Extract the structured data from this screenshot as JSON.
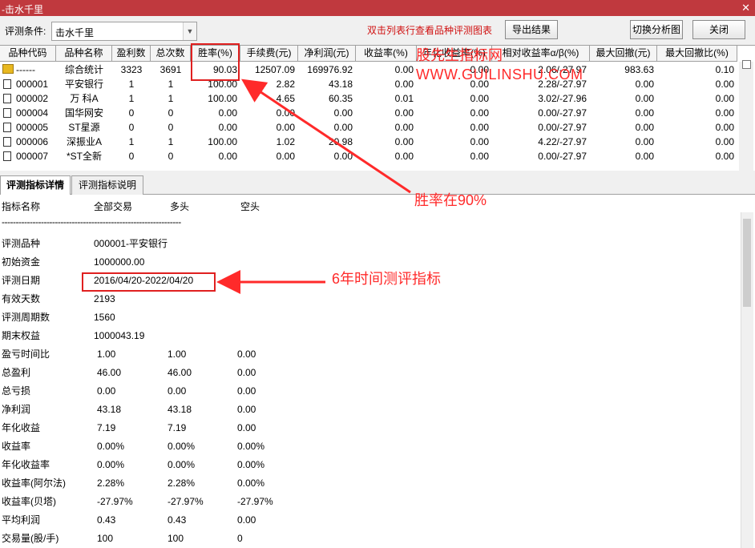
{
  "window": {
    "title": "-击水千里",
    "close_label": "✕"
  },
  "toolbar": {
    "condition_label": "评测条件:",
    "condition_value": "击水千里",
    "hint": "双击列表行查看品种评测图表",
    "export_label": "导出结果",
    "switch_label": "切换分析图",
    "close_label": "关闭"
  },
  "table": {
    "columns": [
      "品种代码",
      "品种名称",
      "盈利数",
      "总次数",
      "胜率(%)",
      "手续费(元)",
      "净利润(元)",
      "收益率(%)",
      "年化收益率(%)",
      "相对收益率α/β(%)",
      "最大回撤(元)",
      "最大回撤比(%)"
    ],
    "rows": [
      [
        "------",
        "综合统计",
        "3323",
        "3691",
        "90.03",
        "12507.09",
        "169976.92",
        "0.00",
        "0.00",
        "2.06/-27.97",
        "983.63",
        "0.10"
      ],
      [
        "000001",
        "平安银行",
        "1",
        "1",
        "100.00",
        "2.82",
        "43.18",
        "0.00",
        "0.00",
        "2.28/-27.97",
        "0.00",
        "0.00"
      ],
      [
        "000002",
        "万 科A",
        "1",
        "1",
        "100.00",
        "4.65",
        "60.35",
        "0.01",
        "0.00",
        "3.02/-27.96",
        "0.00",
        "0.00"
      ],
      [
        "000004",
        "国华网安",
        "0",
        "0",
        "0.00",
        "0.00",
        "0.00",
        "0.00",
        "0.00",
        "0.00/-27.97",
        "0.00",
        "0.00"
      ],
      [
        "000005",
        "ST星源",
        "0",
        "0",
        "0.00",
        "0.00",
        "0.00",
        "0.00",
        "0.00",
        "0.00/-27.97",
        "0.00",
        "0.00"
      ],
      [
        "000006",
        "深振业A",
        "1",
        "1",
        "100.00",
        "1.02",
        "20.98",
        "0.00",
        "0.00",
        "4.22/-27.97",
        "0.00",
        "0.00"
      ],
      [
        "000007",
        "*ST全新",
        "0",
        "0",
        "0.00",
        "0.00",
        "0.00",
        "0.00",
        "0.00",
        "0.00/-27.97",
        "0.00",
        "0.00"
      ]
    ]
  },
  "watermark": {
    "line1": "股先生指标网",
    "line2": "WWW.GUILINSHU.COM"
  },
  "annotations": {
    "win_rate": "胜率在90%",
    "period": "6年时间测评指标"
  },
  "tabs": [
    "评测指标详情",
    "评测指标说明"
  ],
  "detail": {
    "header": [
      "指标名称",
      "全部交易",
      "多头",
      "空头"
    ],
    "separator": "----------------------------------------------------------------",
    "rows": [
      [
        "评测品种",
        "000001-平安银行",
        "",
        ""
      ],
      [
        "初始资金",
        "1000000.00",
        "",
        ""
      ],
      [
        "评测日期",
        "2016/04/20-2022/04/20",
        "",
        ""
      ],
      [
        "有效天数",
        "2193",
        "",
        ""
      ],
      [
        "评测周期数",
        "1560",
        "",
        ""
      ],
      [
        "期末权益",
        "1000043.19",
        "",
        ""
      ],
      [
        "盈亏时间比",
        "1.00",
        "1.00",
        "0.00"
      ],
      [
        "总盈利",
        "46.00",
        "46.00",
        "0.00"
      ],
      [
        "总亏损",
        "0.00",
        "0.00",
        "0.00"
      ],
      [
        "净利润",
        "43.18",
        "43.18",
        "0.00"
      ],
      [
        "年化收益",
        "7.19",
        "7.19",
        "0.00"
      ],
      [
        "收益率",
        "0.00%",
        "0.00%",
        "0.00%"
      ],
      [
        "年化收益率",
        "0.00%",
        "0.00%",
        "0.00%"
      ],
      [
        "收益率(阿尔法)",
        "2.28%",
        "2.28%",
        "0.00%"
      ],
      [
        "收益率(贝塔)",
        "-27.97%",
        "-27.97%",
        "-27.97%"
      ],
      [
        "平均利润",
        "0.43",
        "0.43",
        "0.00"
      ],
      [
        "交易量(股/手)",
        "100",
        "100",
        "0"
      ]
    ]
  },
  "colors": {
    "titlebar": "#c0393e",
    "annotation": "#ff2a2a",
    "highlight_box": "#e02020"
  }
}
